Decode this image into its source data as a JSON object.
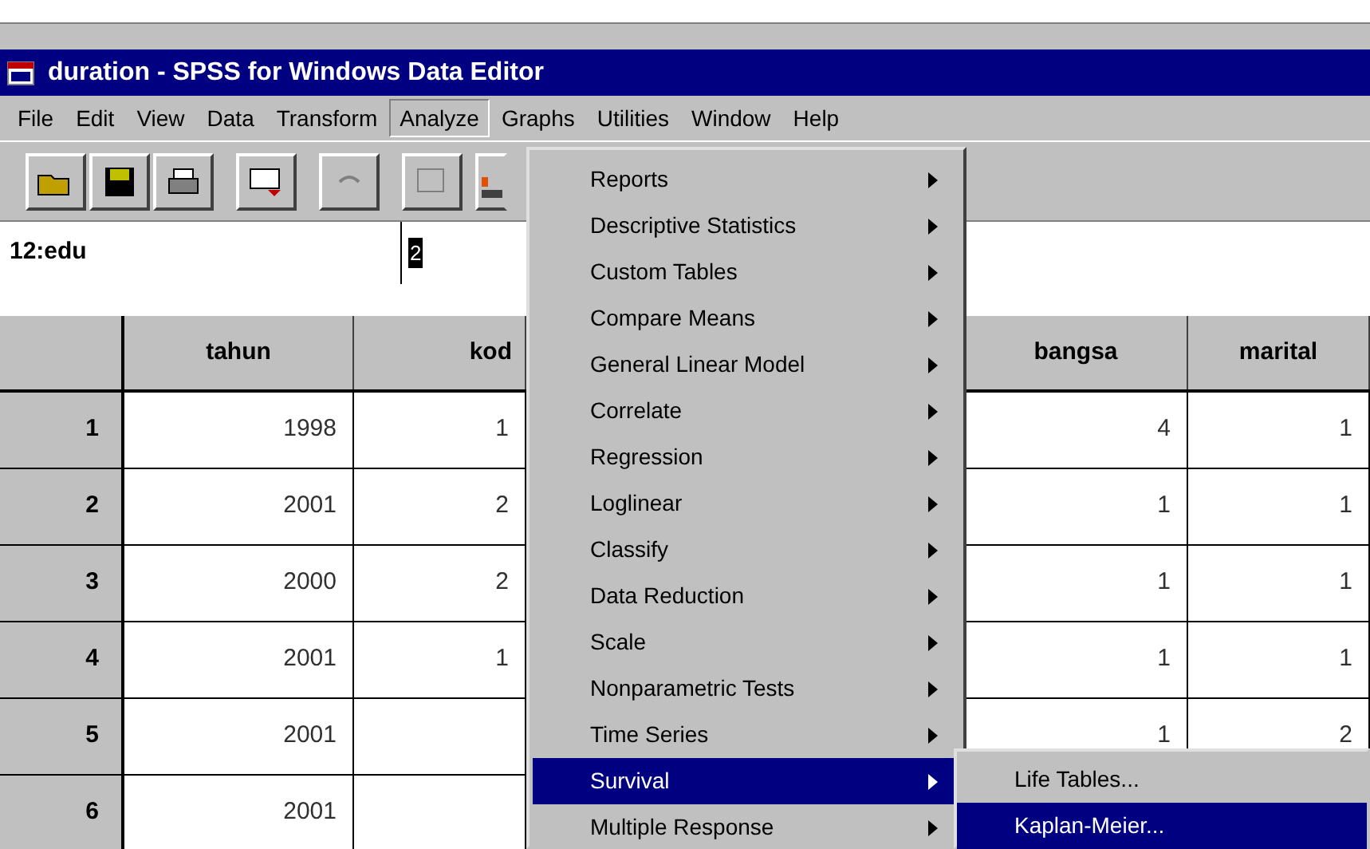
{
  "window": {
    "title": "duration - SPSS for Windows Data Editor"
  },
  "menu_bar": [
    {
      "label": "File",
      "selected": false
    },
    {
      "label": "Edit",
      "selected": false
    },
    {
      "label": "View",
      "selected": false
    },
    {
      "label": "Data",
      "selected": false
    },
    {
      "label": "Transform",
      "selected": false
    },
    {
      "label": "Analyze",
      "selected": true
    },
    {
      "label": "Graphs",
      "selected": false
    },
    {
      "label": "Utilities",
      "selected": false
    },
    {
      "label": "Window",
      "selected": false
    },
    {
      "label": "Help",
      "selected": false
    }
  ],
  "cell_editor": {
    "cell": "12:edu",
    "value": "2"
  },
  "table": {
    "columns": [
      "tahun",
      "kod",
      "bangsa",
      "marital"
    ],
    "rows": [
      {
        "number": "1",
        "cells": [
          "1998",
          "1",
          "4",
          "1"
        ]
      },
      {
        "number": "2",
        "cells": [
          "2001",
          "2",
          "1",
          "1"
        ]
      },
      {
        "number": "3",
        "cells": [
          "2000",
          "2",
          "1",
          "1"
        ]
      },
      {
        "number": "4",
        "cells": [
          "2001",
          "1",
          "1",
          "1"
        ]
      },
      {
        "number": "5",
        "cells": [
          "2001",
          null,
          "1",
          "2"
        ]
      },
      {
        "number": "6",
        "cells": [
          "2001",
          null
        ]
      }
    ]
  },
  "analyze_menu": [
    {
      "label": "Reports",
      "selected": false
    },
    {
      "label": "Descriptive Statistics",
      "selected": false
    },
    {
      "label": "Custom Tables",
      "selected": false
    },
    {
      "label": "Compare Means",
      "selected": false
    },
    {
      "label": "General Linear Model",
      "selected": false
    },
    {
      "label": "Correlate",
      "selected": false
    },
    {
      "label": "Regression",
      "selected": false
    },
    {
      "label": "Loglinear",
      "selected": false
    },
    {
      "label": "Classify",
      "selected": false
    },
    {
      "label": "Data Reduction",
      "selected": false
    },
    {
      "label": "Scale",
      "selected": false
    },
    {
      "label": "Nonparametric Tests",
      "selected": false
    },
    {
      "label": "Time Series",
      "selected": false
    },
    {
      "label": "Survival",
      "selected": true
    },
    {
      "label": "Multiple Response",
      "selected": false
    }
  ],
  "survival_submenu": [
    {
      "label": "Life Tables...",
      "selected": false
    },
    {
      "label": "Kaplan-Meier...",
      "selected": true
    }
  ]
}
